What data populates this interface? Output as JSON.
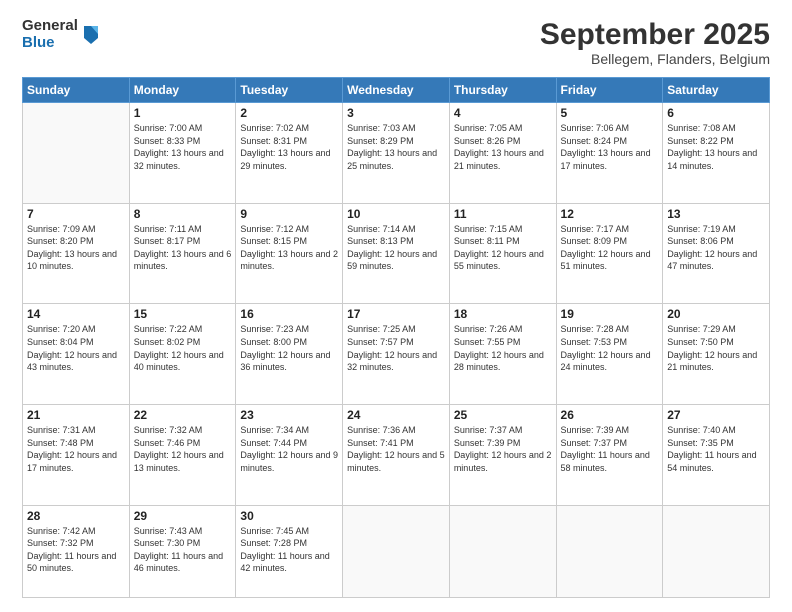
{
  "logo": {
    "general": "General",
    "blue": "Blue"
  },
  "header": {
    "month": "September 2025",
    "location": "Bellegem, Flanders, Belgium"
  },
  "weekdays": [
    "Sunday",
    "Monday",
    "Tuesday",
    "Wednesday",
    "Thursday",
    "Friday",
    "Saturday"
  ],
  "weeks": [
    [
      {
        "day": "",
        "sunrise": "",
        "sunset": "",
        "daylight": ""
      },
      {
        "day": "1",
        "sunrise": "Sunrise: 7:00 AM",
        "sunset": "Sunset: 8:33 PM",
        "daylight": "Daylight: 13 hours and 32 minutes."
      },
      {
        "day": "2",
        "sunrise": "Sunrise: 7:02 AM",
        "sunset": "Sunset: 8:31 PM",
        "daylight": "Daylight: 13 hours and 29 minutes."
      },
      {
        "day": "3",
        "sunrise": "Sunrise: 7:03 AM",
        "sunset": "Sunset: 8:29 PM",
        "daylight": "Daylight: 13 hours and 25 minutes."
      },
      {
        "day": "4",
        "sunrise": "Sunrise: 7:05 AM",
        "sunset": "Sunset: 8:26 PM",
        "daylight": "Daylight: 13 hours and 21 minutes."
      },
      {
        "day": "5",
        "sunrise": "Sunrise: 7:06 AM",
        "sunset": "Sunset: 8:24 PM",
        "daylight": "Daylight: 13 hours and 17 minutes."
      },
      {
        "day": "6",
        "sunrise": "Sunrise: 7:08 AM",
        "sunset": "Sunset: 8:22 PM",
        "daylight": "Daylight: 13 hours and 14 minutes."
      }
    ],
    [
      {
        "day": "7",
        "sunrise": "Sunrise: 7:09 AM",
        "sunset": "Sunset: 8:20 PM",
        "daylight": "Daylight: 13 hours and 10 minutes."
      },
      {
        "day": "8",
        "sunrise": "Sunrise: 7:11 AM",
        "sunset": "Sunset: 8:17 PM",
        "daylight": "Daylight: 13 hours and 6 minutes."
      },
      {
        "day": "9",
        "sunrise": "Sunrise: 7:12 AM",
        "sunset": "Sunset: 8:15 PM",
        "daylight": "Daylight: 13 hours and 2 minutes."
      },
      {
        "day": "10",
        "sunrise": "Sunrise: 7:14 AM",
        "sunset": "Sunset: 8:13 PM",
        "daylight": "Daylight: 12 hours and 59 minutes."
      },
      {
        "day": "11",
        "sunrise": "Sunrise: 7:15 AM",
        "sunset": "Sunset: 8:11 PM",
        "daylight": "Daylight: 12 hours and 55 minutes."
      },
      {
        "day": "12",
        "sunrise": "Sunrise: 7:17 AM",
        "sunset": "Sunset: 8:09 PM",
        "daylight": "Daylight: 12 hours and 51 minutes."
      },
      {
        "day": "13",
        "sunrise": "Sunrise: 7:19 AM",
        "sunset": "Sunset: 8:06 PM",
        "daylight": "Daylight: 12 hours and 47 minutes."
      }
    ],
    [
      {
        "day": "14",
        "sunrise": "Sunrise: 7:20 AM",
        "sunset": "Sunset: 8:04 PM",
        "daylight": "Daylight: 12 hours and 43 minutes."
      },
      {
        "day": "15",
        "sunrise": "Sunrise: 7:22 AM",
        "sunset": "Sunset: 8:02 PM",
        "daylight": "Daylight: 12 hours and 40 minutes."
      },
      {
        "day": "16",
        "sunrise": "Sunrise: 7:23 AM",
        "sunset": "Sunset: 8:00 PM",
        "daylight": "Daylight: 12 hours and 36 minutes."
      },
      {
        "day": "17",
        "sunrise": "Sunrise: 7:25 AM",
        "sunset": "Sunset: 7:57 PM",
        "daylight": "Daylight: 12 hours and 32 minutes."
      },
      {
        "day": "18",
        "sunrise": "Sunrise: 7:26 AM",
        "sunset": "Sunset: 7:55 PM",
        "daylight": "Daylight: 12 hours and 28 minutes."
      },
      {
        "day": "19",
        "sunrise": "Sunrise: 7:28 AM",
        "sunset": "Sunset: 7:53 PM",
        "daylight": "Daylight: 12 hours and 24 minutes."
      },
      {
        "day": "20",
        "sunrise": "Sunrise: 7:29 AM",
        "sunset": "Sunset: 7:50 PM",
        "daylight": "Daylight: 12 hours and 21 minutes."
      }
    ],
    [
      {
        "day": "21",
        "sunrise": "Sunrise: 7:31 AM",
        "sunset": "Sunset: 7:48 PM",
        "daylight": "Daylight: 12 hours and 17 minutes."
      },
      {
        "day": "22",
        "sunrise": "Sunrise: 7:32 AM",
        "sunset": "Sunset: 7:46 PM",
        "daylight": "Daylight: 12 hours and 13 minutes."
      },
      {
        "day": "23",
        "sunrise": "Sunrise: 7:34 AM",
        "sunset": "Sunset: 7:44 PM",
        "daylight": "Daylight: 12 hours and 9 minutes."
      },
      {
        "day": "24",
        "sunrise": "Sunrise: 7:36 AM",
        "sunset": "Sunset: 7:41 PM",
        "daylight": "Daylight: 12 hours and 5 minutes."
      },
      {
        "day": "25",
        "sunrise": "Sunrise: 7:37 AM",
        "sunset": "Sunset: 7:39 PM",
        "daylight": "Daylight: 12 hours and 2 minutes."
      },
      {
        "day": "26",
        "sunrise": "Sunrise: 7:39 AM",
        "sunset": "Sunset: 7:37 PM",
        "daylight": "Daylight: 11 hours and 58 minutes."
      },
      {
        "day": "27",
        "sunrise": "Sunrise: 7:40 AM",
        "sunset": "Sunset: 7:35 PM",
        "daylight": "Daylight: 11 hours and 54 minutes."
      }
    ],
    [
      {
        "day": "28",
        "sunrise": "Sunrise: 7:42 AM",
        "sunset": "Sunset: 7:32 PM",
        "daylight": "Daylight: 11 hours and 50 minutes."
      },
      {
        "day": "29",
        "sunrise": "Sunrise: 7:43 AM",
        "sunset": "Sunset: 7:30 PM",
        "daylight": "Daylight: 11 hours and 46 minutes."
      },
      {
        "day": "30",
        "sunrise": "Sunrise: 7:45 AM",
        "sunset": "Sunset: 7:28 PM",
        "daylight": "Daylight: 11 hours and 42 minutes."
      },
      {
        "day": "",
        "sunrise": "",
        "sunset": "",
        "daylight": ""
      },
      {
        "day": "",
        "sunrise": "",
        "sunset": "",
        "daylight": ""
      },
      {
        "day": "",
        "sunrise": "",
        "sunset": "",
        "daylight": ""
      },
      {
        "day": "",
        "sunrise": "",
        "sunset": "",
        "daylight": ""
      }
    ]
  ]
}
